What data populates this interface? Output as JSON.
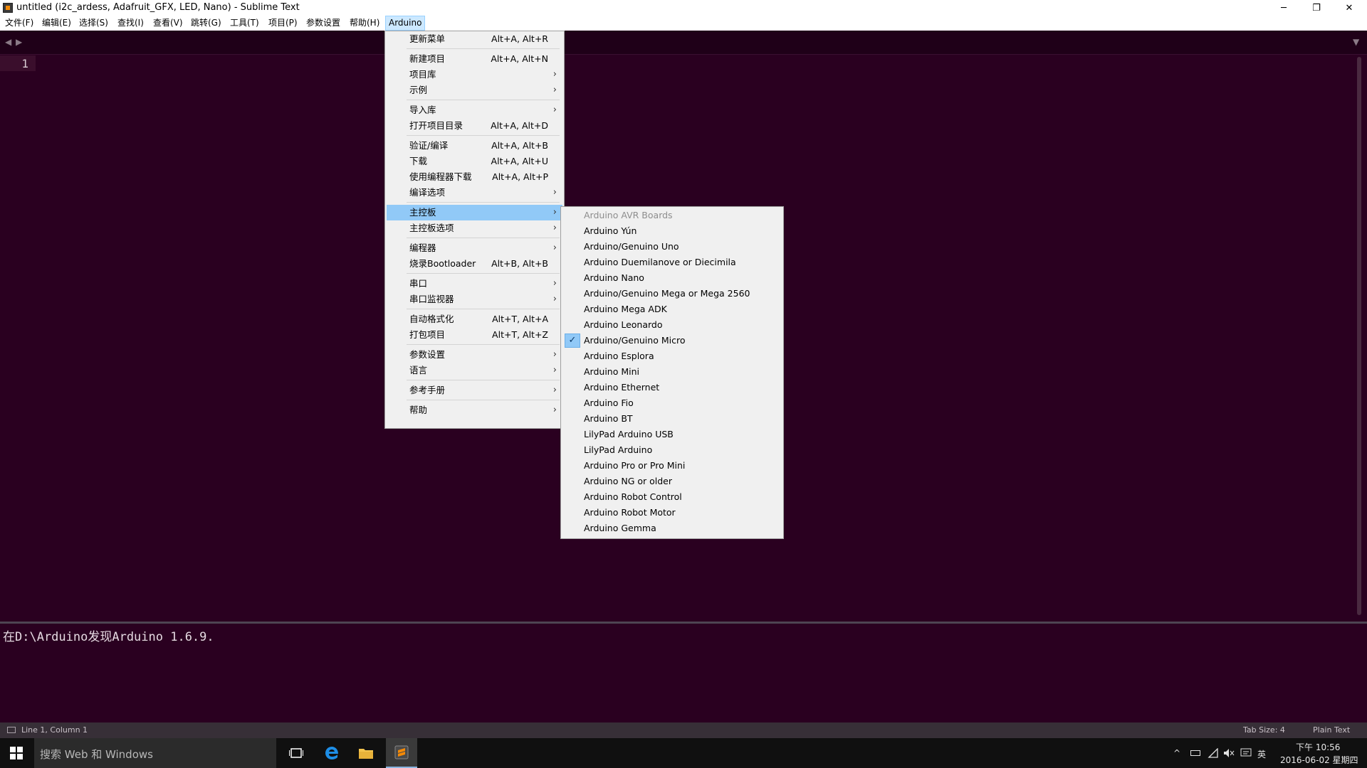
{
  "window": {
    "title": "untitled (i2c_ardess, Adafruit_GFX, LED, Nano) - Sublime Text",
    "min_glyph": "─",
    "max_glyph": "❐",
    "close_glyph": "✕"
  },
  "menubar": {
    "items": [
      {
        "label": "文件(F)"
      },
      {
        "label": "编辑(E)"
      },
      {
        "label": "选择(S)"
      },
      {
        "label": "查找(I)"
      },
      {
        "label": "查看(V)"
      },
      {
        "label": "跳转(G)"
      },
      {
        "label": "工具(T)"
      },
      {
        "label": "项目(P)"
      },
      {
        "label": "参数设置"
      },
      {
        "label": "帮助(H)"
      },
      {
        "label": "Arduino"
      }
    ]
  },
  "tabbar": {
    "left_arrow": "◀",
    "right_arrow": "▶",
    "dropdown": "▼"
  },
  "editor": {
    "line_number": "1"
  },
  "output": {
    "text": "在D:\\Arduino发现Arduino 1.6.9."
  },
  "arduino_menu": {
    "items": [
      {
        "label": "更新菜单",
        "shortcut": "Alt+A, Alt+R",
        "arrow": ""
      },
      {
        "label": "新建项目",
        "shortcut": "Alt+A, Alt+N",
        "arrow": ""
      },
      {
        "label": "项目库",
        "shortcut": "",
        "arrow": "›"
      },
      {
        "label": "示例",
        "shortcut": "",
        "arrow": "›"
      },
      {
        "label": "导入库",
        "shortcut": "",
        "arrow": "›"
      },
      {
        "label": "打开项目目录",
        "shortcut": "Alt+A, Alt+D",
        "arrow": ""
      },
      {
        "label": "验证/编译",
        "shortcut": "Alt+A, Alt+B",
        "arrow": ""
      },
      {
        "label": "下载",
        "shortcut": "Alt+A, Alt+U",
        "arrow": ""
      },
      {
        "label": "使用编程器下载",
        "shortcut": "Alt+A, Alt+P",
        "arrow": ""
      },
      {
        "label": "编译选项",
        "shortcut": "",
        "arrow": "›"
      },
      {
        "label": "主控板",
        "shortcut": "",
        "arrow": "›"
      },
      {
        "label": "主控板选项",
        "shortcut": "",
        "arrow": "›"
      },
      {
        "label": "编程器",
        "shortcut": "",
        "arrow": "›"
      },
      {
        "label": "烧录Bootloader",
        "shortcut": "Alt+B, Alt+B",
        "arrow": ""
      },
      {
        "label": "串口",
        "shortcut": "",
        "arrow": "›"
      },
      {
        "label": "串口监视器",
        "shortcut": "",
        "arrow": "›"
      },
      {
        "label": "自动格式化",
        "shortcut": "Alt+T, Alt+A",
        "arrow": ""
      },
      {
        "label": "打包项目",
        "shortcut": "Alt+T, Alt+Z",
        "arrow": ""
      },
      {
        "label": "参数设置",
        "shortcut": "",
        "arrow": "›"
      },
      {
        "label": "语言",
        "shortcut": "",
        "arrow": "›"
      },
      {
        "label": "参考手册",
        "shortcut": "",
        "arrow": "›"
      },
      {
        "label": "帮助",
        "shortcut": "",
        "arrow": "›"
      }
    ]
  },
  "boards_menu": {
    "header": "Arduino AVR Boards",
    "check_glyph": "✓",
    "selected": "Arduino/Genuino Micro",
    "items": [
      {
        "label": "Arduino Yún"
      },
      {
        "label": "Arduino/Genuino Uno"
      },
      {
        "label": "Arduino Duemilanove or Diecimila"
      },
      {
        "label": "Arduino Nano"
      },
      {
        "label": "Arduino/Genuino Mega or Mega 2560"
      },
      {
        "label": "Arduino Mega ADK"
      },
      {
        "label": "Arduino Leonardo"
      },
      {
        "label": "Arduino/Genuino Micro"
      },
      {
        "label": "Arduino Esplora"
      },
      {
        "label": "Arduino Mini"
      },
      {
        "label": "Arduino Ethernet"
      },
      {
        "label": "Arduino Fio"
      },
      {
        "label": "Arduino BT"
      },
      {
        "label": "LilyPad Arduino USB"
      },
      {
        "label": "LilyPad Arduino"
      },
      {
        "label": "Arduino Pro or Pro Mini"
      },
      {
        "label": "Arduino NG or older"
      },
      {
        "label": "Arduino Robot Control"
      },
      {
        "label": "Arduino Robot Motor"
      },
      {
        "label": "Arduino Gemma"
      }
    ]
  },
  "statusbar": {
    "position": "Line 1, Column 1",
    "tab_size": "Tab Size: 4",
    "syntax": "Plain Text"
  },
  "taskbar": {
    "search_placeholder": "搜索 Web 和 Windows",
    "time": "下午 10:56",
    "date": "2016-06-02 星期四",
    "ime": "英",
    "chevron": "^"
  },
  "colors": {
    "editor_bg": "#2a0020",
    "menu_bg": "#f0f0f0",
    "highlight": "#91c9f7",
    "statusbar_bg": "#372f37",
    "taskbar_bg": "#101010"
  }
}
